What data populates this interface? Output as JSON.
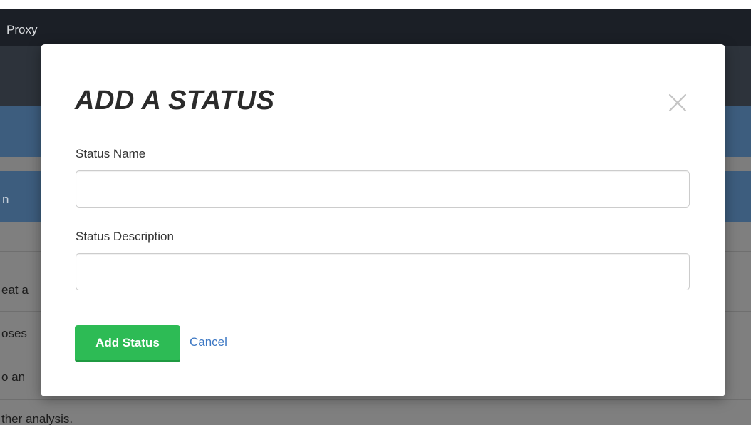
{
  "background": {
    "navbar": {
      "brand_text": "Proxy"
    },
    "table_row_fragments": {
      "row_header": "n",
      "row_1": "eat a",
      "row_2": "oses",
      "row_3": "o an",
      "row_4": "ther analysis."
    }
  },
  "modal": {
    "title": "ADD A STATUS",
    "close_icon": "close-x-icon",
    "fields": {
      "name": {
        "label": "Status Name",
        "value": "",
        "placeholder": ""
      },
      "description": {
        "label": "Status Description",
        "value": "",
        "placeholder": ""
      }
    },
    "actions": {
      "submit_label": "Add Status",
      "cancel_label": "Cancel"
    }
  },
  "colors": {
    "primary_green": "#2dbb55",
    "link_blue": "#3d78c4",
    "navbar_dark": "#1b1f26",
    "header_blue": "#3d5d7e"
  }
}
